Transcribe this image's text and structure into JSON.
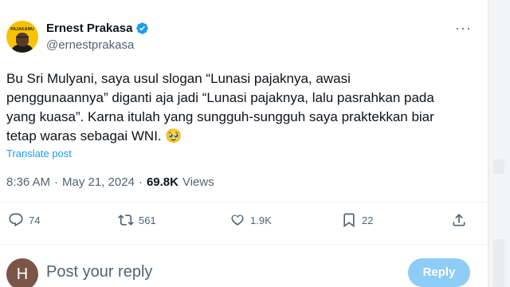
{
  "author": {
    "name": "Ernest Prakasa",
    "handle": "@ernestprakasa",
    "avatar_banner": "PAJAKAMU"
  },
  "tweet": {
    "text_lines": [
      "Bu Sri Mulyani, saya usul slogan “Lunasi pajaknya, awasi",
      "penggunaannya” diganti aja jadi “Lunasi pajaknya, lalu pasrahkan pada",
      "yang kuasa”. Karna itulah yang sungguh-sungguh saya praktekkan biar",
      "tetap waras sebagai WNI. 🥹"
    ],
    "translate_label": "Translate post",
    "time": "8:36 AM",
    "separator": "·",
    "date": "May 21, 2024",
    "views_count": "69.8K",
    "views_label": "Views"
  },
  "actions": {
    "replies": "74",
    "reposts": "561",
    "likes": "1.9K",
    "bookmarks": "22"
  },
  "reply": {
    "avatar_initial": "H",
    "placeholder": "Post your reply",
    "button_label": "Reply"
  },
  "colors": {
    "accent": "#1d9bf0",
    "muted": "#536471",
    "reply_button": "#8ecdf7"
  }
}
